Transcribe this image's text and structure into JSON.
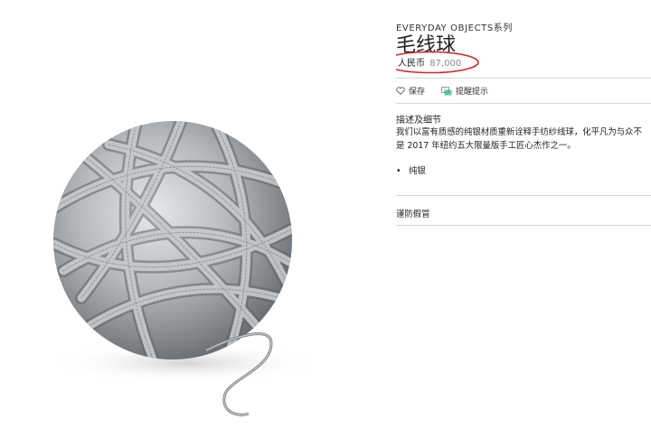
{
  "product": {
    "collection": "EVERYDAY OBJECTS系列",
    "name": "毛线球",
    "price_currency": "人民币",
    "price_amount": "87,000"
  },
  "actions": {
    "save_label": "保存",
    "hint_label": "提醒提示"
  },
  "details": {
    "heading": "描述及细节",
    "description_lines": [
      "我们以富有质感的纯银材质重新诠释手纺纱线球，化平凡为与众不",
      "是 2017 年纽约五大限量版手工匠心杰作之一。"
    ],
    "bullets": [
      "纯银"
    ]
  },
  "anti_counterfeit_label": "谨防假冒",
  "colors": {
    "highlight_circle": "#d22a2a",
    "divider": "#d9d9d9",
    "hint_icon_accent": "#2bb5a0"
  }
}
